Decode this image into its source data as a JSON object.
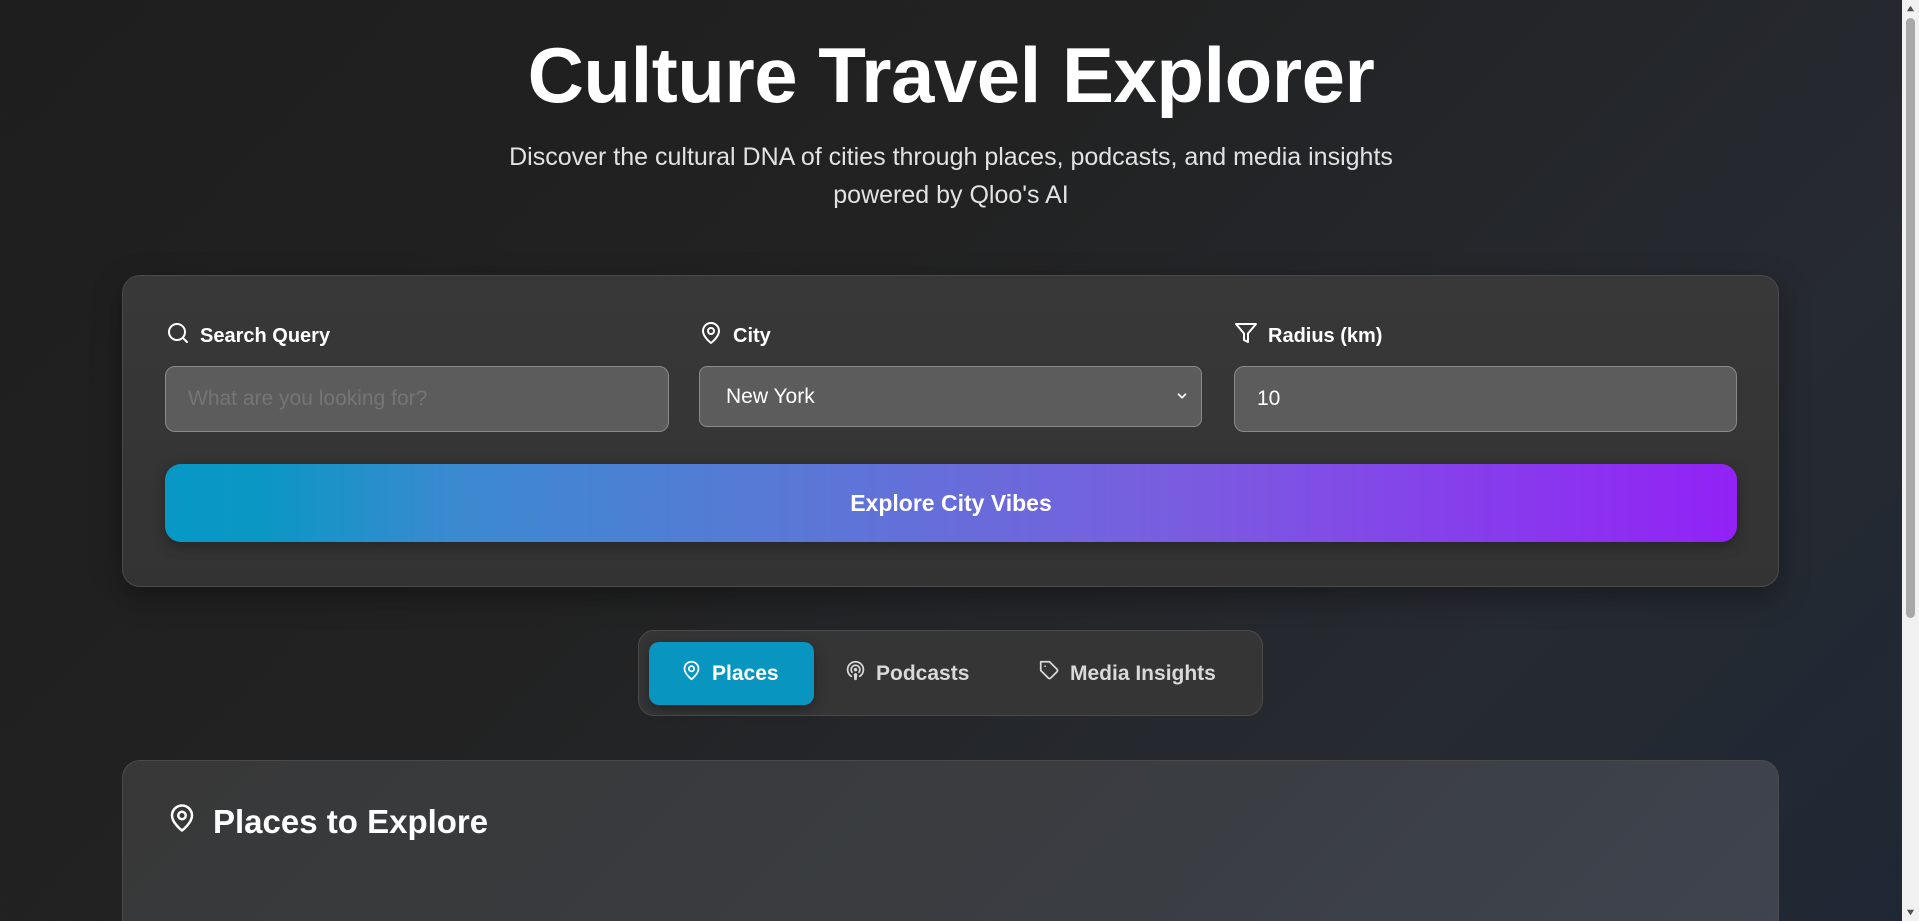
{
  "header": {
    "title": "Culture Travel Explorer",
    "subtitle_line1": "Discover the cultural DNA of cities through places, podcasts, and media insights",
    "subtitle_line2": "powered by Qloo's AI"
  },
  "search": {
    "query_label": "Search Query",
    "query_placeholder": "What are you looking for?",
    "query_value": "",
    "city_label": "City",
    "city_value": "New York",
    "radius_label": "Radius (km)",
    "radius_value": "10",
    "explore_label": "Explore City Vibes"
  },
  "tabs": [
    {
      "label": "Places",
      "icon": "map-pin-icon",
      "active": true
    },
    {
      "label": "Podcasts",
      "icon": "podcast-icon",
      "active": false
    },
    {
      "label": "Media Insights",
      "icon": "tag-icon",
      "active": false
    }
  ],
  "results": {
    "heading": "Places to Explore",
    "icon": "map-pin-icon"
  },
  "colors": {
    "accent_start": "#0898c6",
    "accent_end": "#9222f6",
    "active_tab": "#0896c1"
  }
}
